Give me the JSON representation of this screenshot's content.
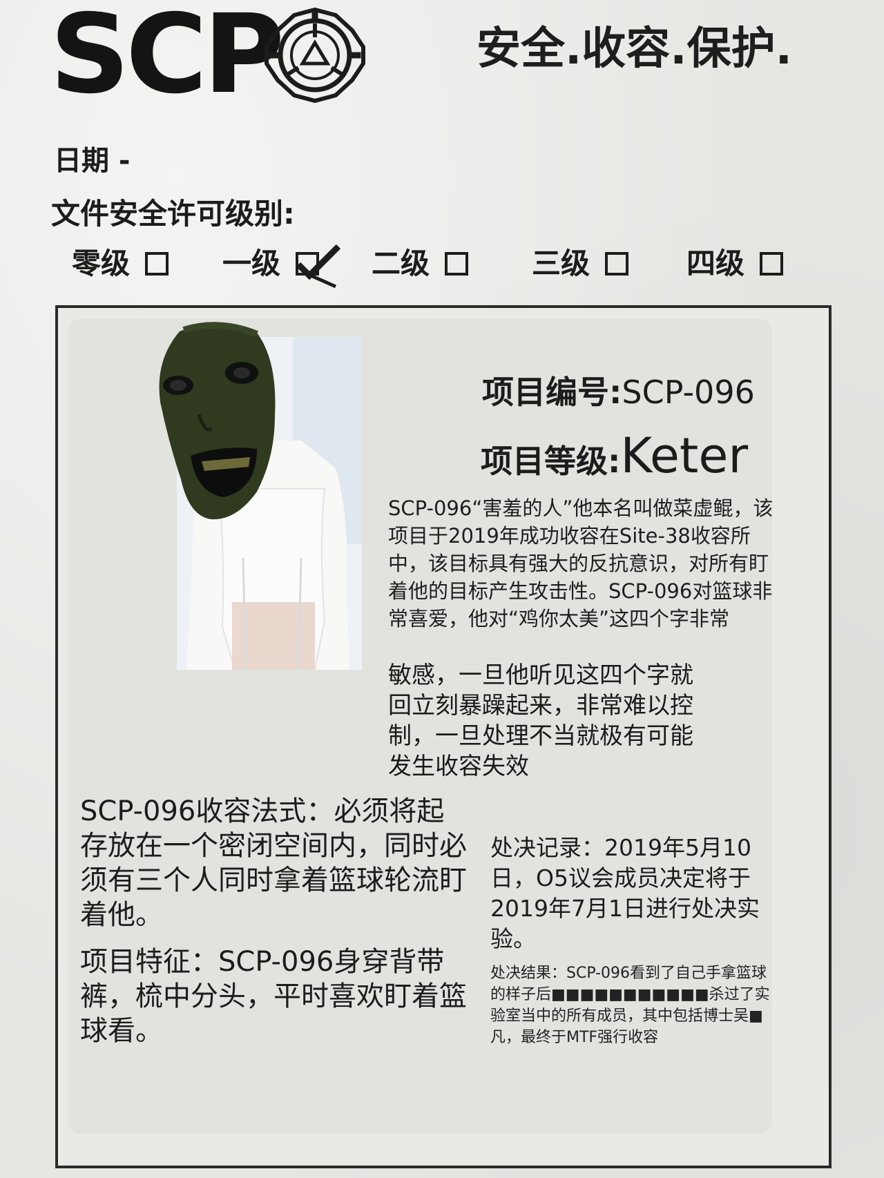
{
  "header": {
    "logo": "SCP",
    "motto": "安全.收容.保护."
  },
  "form": {
    "date_label": "日期 -",
    "clearance_label": "文件安全许可级别:",
    "levels": [
      {
        "label": "零级",
        "checked": false
      },
      {
        "label": "一级",
        "checked": true
      },
      {
        "label": "二级",
        "checked": false
      },
      {
        "label": "三级",
        "checked": false
      },
      {
        "label": "四级",
        "checked": false
      }
    ]
  },
  "item": {
    "number_label": "项目编号:",
    "number_value": "SCP-096",
    "class_label": "项目等级:",
    "class_value": "Keter",
    "description": "SCP-096“害羞的人”他本名叫做菜虚鲲，该项目于2019年成功收容在Site-38收容所中，该目标具有强大的反抗意识，对所有盯着他的目标产生攻击性。SCP-096对篮球非常喜爱，他对“鸡你太美”这四个字非常",
    "description_tail": "敏感，一旦他听见这四个字就回立刻暴躁起来，非常难以控制，一旦处理不当就极有可能发生收容失效",
    "procedures": "SCP-096收容法式：必须将起存放在一个密闭空间内，同时必须有三个人同时拿着篮球轮流盯着他。",
    "features": "项目特征：SCP-096身穿背带裤，梳中分头，平时喜欢盯着篮球看。",
    "execution_record": "处决记录：2019年5月10日，O5议会成员决定将于2019年7月1日进行处决实验。",
    "execution_result": "处决结果：SCP-096看到了自己手拿篮球的样子后■■■■■■■■■■■杀过了实验室当中的所有成员，其中包括博士吴■凡，最终于MTF强行收容"
  },
  "colors": {
    "paper": "#e6e6e3",
    "ink": "#1c1c1c",
    "photo_face": "#2f3a1e"
  },
  "icons": [
    "scp-seal-icon",
    "checkbox-icon",
    "check-mark-icon"
  ]
}
